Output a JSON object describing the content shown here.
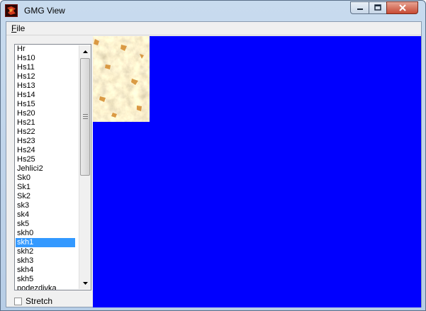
{
  "window": {
    "title": "GMG View"
  },
  "menu": {
    "file_label": "F",
    "file_label_rest": "ile"
  },
  "list": {
    "items": [
      "Hr",
      "Hs10",
      "Hs11",
      "Hs12",
      "Hs13",
      "Hs14",
      "Hs15",
      "Hs20",
      "Hs21",
      "Hs22",
      "Hs23",
      "Hs24",
      "Hs25",
      "Jehlici2",
      "Sk0",
      "Sk1",
      "Sk2",
      "sk3",
      "sk4",
      "sk5",
      "skh0",
      "skh1",
      "skh2",
      "skh3",
      "skh4",
      "skh5",
      "podezdivka"
    ],
    "selected": "skh1"
  },
  "stretch": {
    "label": "Stretch",
    "checked": false
  },
  "colors": {
    "viewer_bg": "#0000ff",
    "selection": "#3399ff"
  },
  "icons": {
    "app": "gmg-app-icon",
    "minimize": "minimize-icon",
    "maximize": "maximize-icon",
    "close": "close-icon"
  }
}
